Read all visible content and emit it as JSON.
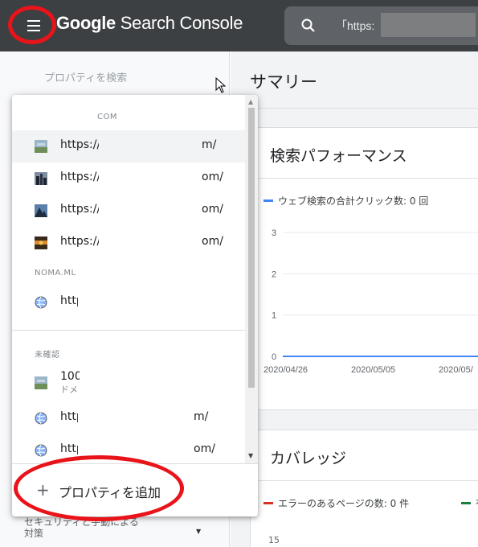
{
  "header": {
    "brand_google": "Google",
    "brand_rest": " Search Console",
    "search_text": "「https:"
  },
  "sidebar": {
    "search_placeholder": "プロパティを検索",
    "bottom_label_1": "セキュリティと手動による",
    "bottom_label_2": "対策"
  },
  "main": {
    "page_title": "サマリー",
    "performance": {
      "title": "検索パフォーマンス",
      "legend": "ウェブ検索の合計クリック数: 0 回"
    },
    "coverage": {
      "title": "カバレッジ",
      "legend_error": "エラーのあるページの数: 0 件",
      "legend_valid": "有",
      "y_tick": "15"
    }
  },
  "property_dropdown": {
    "groups": [
      {
        "label": "COM",
        "items": [
          {
            "prefix": "https://",
            "suffix": "m/",
            "icon": "landscape-thumbnail-icon"
          },
          {
            "prefix": "https://",
            "suffix": "om/",
            "icon": "city-thumbnail-icon"
          },
          {
            "prefix": "https://",
            "suffix": "om/",
            "icon": "mountain-thumbnail-icon"
          },
          {
            "prefix": "https://",
            "suffix": "om/",
            "icon": "sunset-thumbnail-icon"
          }
        ]
      },
      {
        "label": "NOMA.ML",
        "items": [
          {
            "prefix": "http",
            "suffix": "",
            "icon": "globe-icon"
          }
        ]
      },
      {
        "label": "未確認",
        "items": [
          {
            "prefix": "100",
            "sub": "ドメ",
            "suffix": "",
            "icon": "landscape-thumbnail-icon"
          },
          {
            "prefix": "http",
            "suffix": "m/",
            "icon": "globe-icon"
          },
          {
            "prefix": "http",
            "suffix": "om/",
            "icon": "globe-icon"
          }
        ]
      }
    ],
    "add_property_label": "プロパティを追加",
    "add_icon": "+"
  },
  "chart_data": {
    "type": "line",
    "title": "",
    "series": [
      {
        "name": "ウェブ検索の合計クリック数",
        "x": [
          "2020/04/26",
          "2020/05/05",
          "2020/05/"
        ],
        "values": [
          0,
          0,
          0
        ]
      }
    ],
    "y_ticks": [
      "3",
      "2",
      "1",
      "0"
    ],
    "x_ticks": [
      "2020/04/26",
      "2020/05/05",
      "2020/05/"
    ],
    "ylim": [
      0,
      3
    ],
    "colors": {
      "series": "#4285f4"
    }
  },
  "colors": {
    "header_bg": "#3c4043",
    "annotation_ring": "#e8141a",
    "legend_error": "#d93025",
    "legend_valid": "#188038"
  }
}
